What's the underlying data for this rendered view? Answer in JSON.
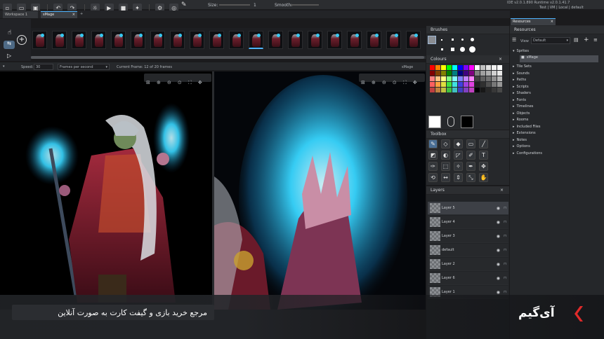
{
  "top_bar": {
    "size_label": "Size:",
    "size_value": "1",
    "smooth_label": "Smooth:",
    "ide_runtime": "IDE v2.0.1.890  Runtime v2.0.1.41.7",
    "targets": [
      "Test",
      "VM",
      "Local",
      "default"
    ]
  },
  "tabs": {
    "workspace": "Workspace 1",
    "sprite": "sMage",
    "resources": "Resources"
  },
  "frame_bar": {
    "speed_label": "Speed:",
    "speed_value": "30",
    "speed_unit": "Frames per second",
    "current_frame": "Current Frame: 12 of 20 frames",
    "sprite_name": "sMage"
  },
  "brushes": {
    "title": "Brushes"
  },
  "colours": {
    "title": "Colours",
    "palette": [
      "#ff0000",
      "#ff8000",
      "#ffff00",
      "#00ff00",
      "#00ffff",
      "#0000ff",
      "#8000ff",
      "#ff00ff",
      "#ffffff",
      "#c0c0c0",
      "#e0e0e0",
      "#f0f0f0",
      "#ffffff",
      "#800000",
      "#804000",
      "#808000",
      "#008000",
      "#008080",
      "#000080",
      "#400080",
      "#800080",
      "#808080",
      "#a0a0a0",
      "#b0b0b0",
      "#d0d0d0",
      "#e8e8e8",
      "#ff8080",
      "#ffc080",
      "#ffff80",
      "#80ff80",
      "#80ffff",
      "#8080ff",
      "#c080ff",
      "#ff80ff",
      "#404040",
      "#606060",
      "#707070",
      "#909090",
      "#b8b8b8",
      "#ff6060",
      "#ffa040",
      "#e0e040",
      "#40e040",
      "#40e0e0",
      "#4040e0",
      "#a040e0",
      "#e040e0",
      "#202020",
      "#303030",
      "#505050",
      "#787878",
      "#989898",
      "#c04040",
      "#c08040",
      "#c0c040",
      "#40c040",
      "#40c0c0",
      "#4040c0",
      "#8040c0",
      "#c040c0",
      "#000000",
      "#181818",
      "#282828",
      "#383838",
      "#484848"
    ],
    "primary": "#ffffff",
    "secondary": "#000000"
  },
  "toolbox": {
    "title": "Toolbox"
  },
  "layers": {
    "title": "Layers",
    "items": [
      "Layer 5",
      "Layer 4",
      "Layer 3",
      "default",
      "Layer 2",
      "Layer 6",
      "Layer 1"
    ]
  },
  "resources": {
    "title": "Resources",
    "view_label": "View",
    "view_value": "Default",
    "tree": [
      {
        "label": "Sprites",
        "expanded": true
      },
      {
        "label": "sMage",
        "child": true,
        "selected": true
      },
      {
        "label": "Tile Sets"
      },
      {
        "label": "Sounds"
      },
      {
        "label": "Paths"
      },
      {
        "label": "Scripts"
      },
      {
        "label": "Shaders"
      },
      {
        "label": "Fonts"
      },
      {
        "label": "Timelines"
      },
      {
        "label": "Objects"
      },
      {
        "label": "Rooms"
      },
      {
        "label": "Included Files"
      },
      {
        "label": "Extensions"
      },
      {
        "label": "Notes"
      },
      {
        "label": "Options"
      },
      {
        "label": "Configurations"
      }
    ]
  },
  "banner": {
    "caption": "مرجع خرید بازی و گیفت کارت به صورت آنلاین",
    "brand": "آی‌گیم"
  },
  "colors": {
    "accent": "#4fb4ff",
    "banner_bg": "#2b2d31",
    "brand_red": "#e02a2a",
    "fire": "#38d6ff",
    "robe": "#7d1c2c"
  }
}
